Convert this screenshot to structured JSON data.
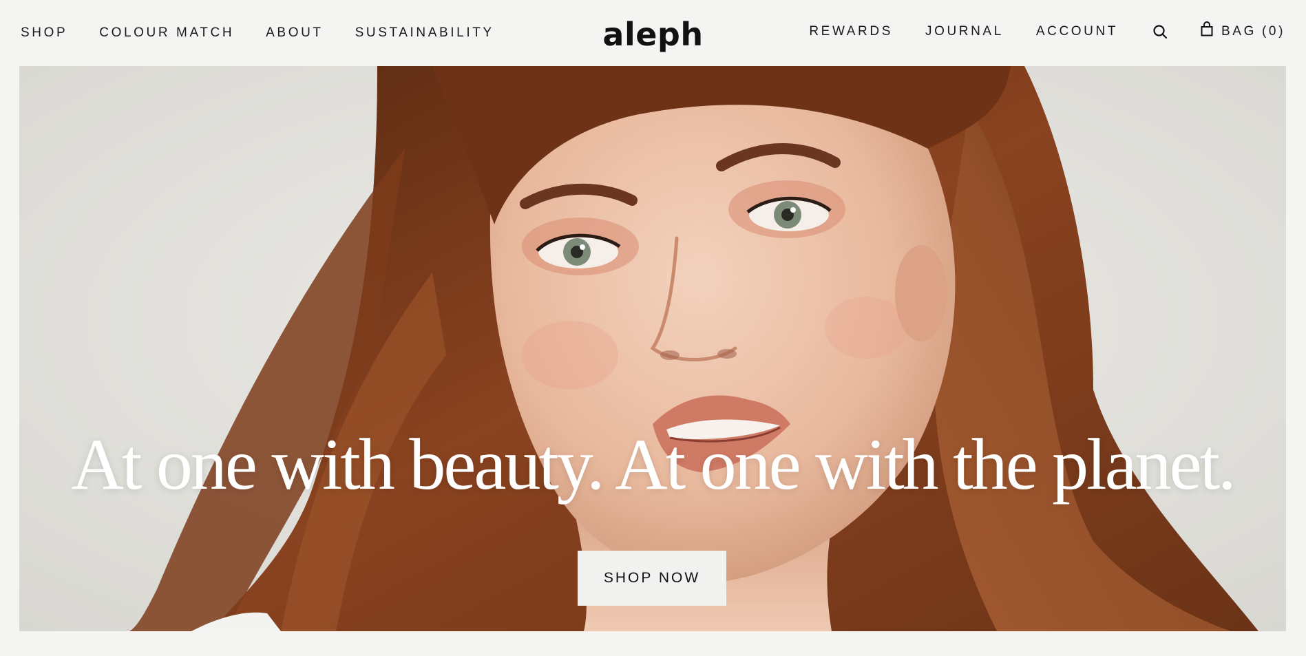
{
  "header": {
    "nav_left": [
      "SHOP",
      "COLOUR MATCH",
      "ABOUT",
      "SUSTAINABILITY"
    ],
    "logo": "aleph",
    "nav_right": [
      "REWARDS",
      "JOURNAL",
      "ACCOUNT"
    ],
    "search_icon": "search-icon",
    "bag_icon": "shopping-bag-icon",
    "bag_label": "BAG",
    "bag_count": "(0)"
  },
  "hero": {
    "headline": "At one with beauty. At one with the planet.",
    "cta_label": "SHOP NOW",
    "image_alt": "Portrait of a woman with auburn hair"
  },
  "colors": {
    "page_background": "#f4f4f2",
    "text": "#1a1a1a",
    "hero_background": "#e4e3df",
    "hair": "#7a3a17",
    "headline": "#ffffff",
    "button_background": "#f1f1f0"
  }
}
